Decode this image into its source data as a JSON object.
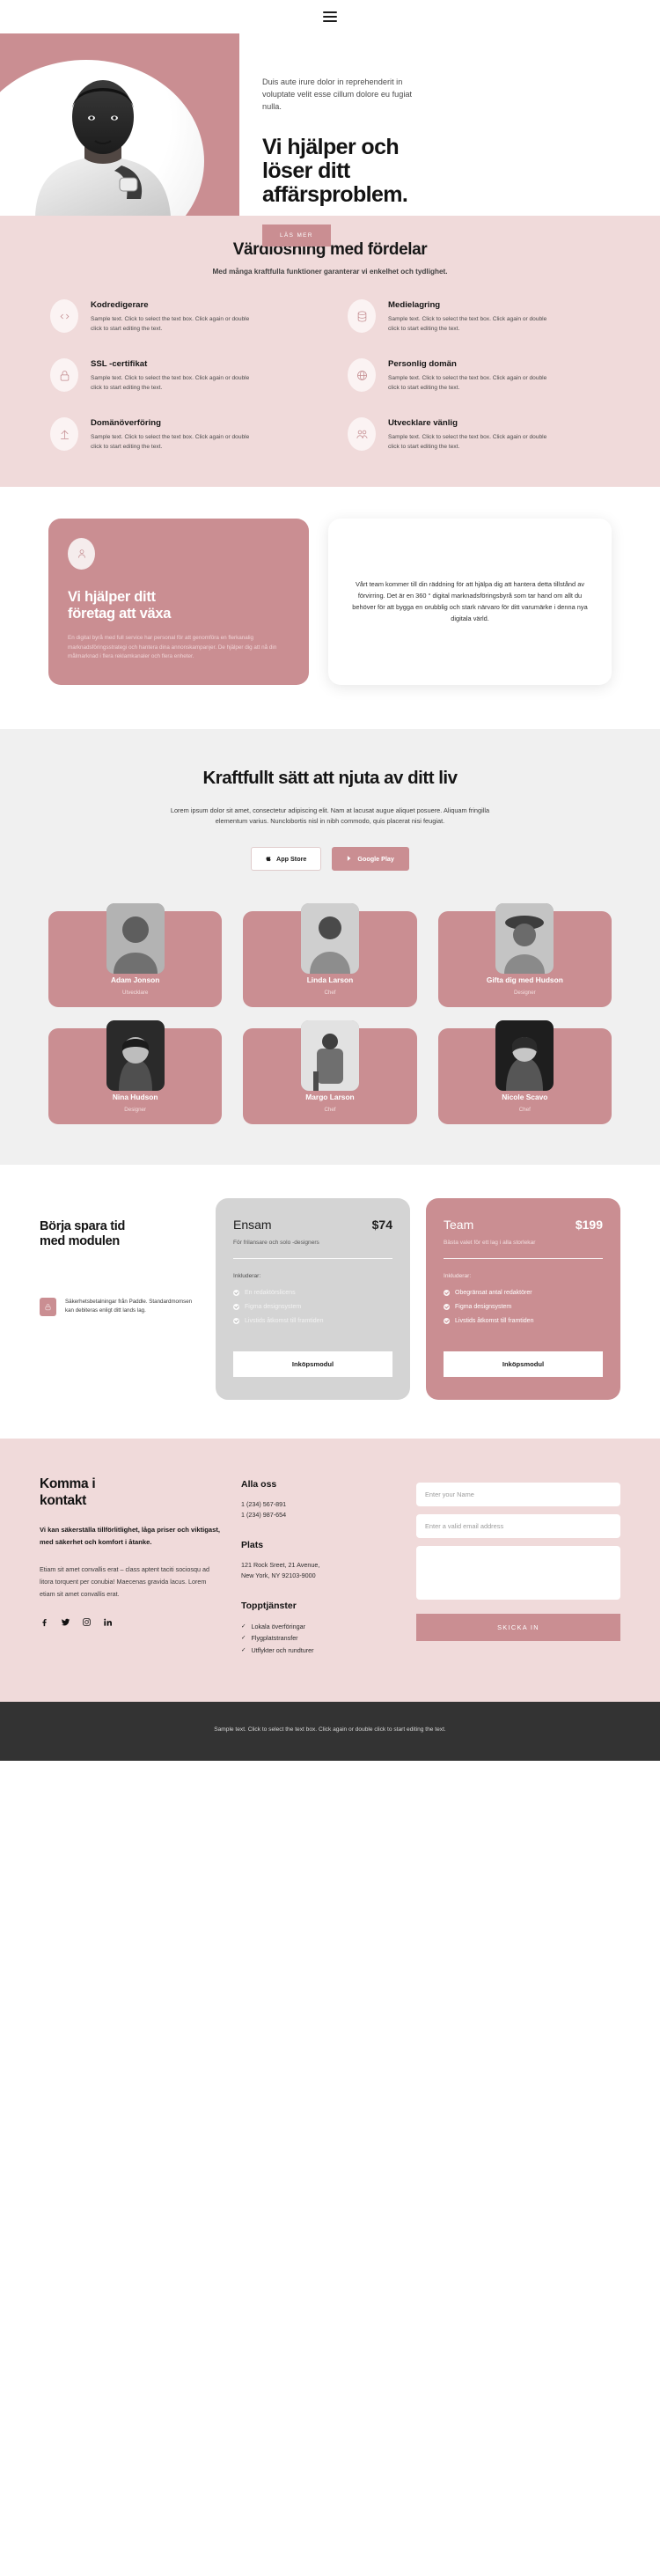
{
  "nav": {
    "menu_label": "menu"
  },
  "hero": {
    "kicker": "Duis aute irure dolor in reprehenderit in voluptate velit esse cillum dolore eu fugiat nulla.",
    "title_line1": "Vi hjälper och",
    "title_line2": "löser ditt",
    "title_line3": "affärsproblem.",
    "cta": "LÄS MER"
  },
  "features": {
    "title": "Värdlösning med fördelar",
    "subtitle": "Med många kraftfulla funktioner garanterar vi enkelhet och tydlighet.",
    "body": "Sample text. Click to select the text box. Click again or double click to start editing the text.",
    "items": [
      {
        "icon": "code-icon",
        "title": "Kodredigerare"
      },
      {
        "icon": "database-icon",
        "title": "Medielagring"
      },
      {
        "icon": "lock-icon",
        "title": "SSL -certifikat"
      },
      {
        "icon": "globe-icon",
        "title": "Personlig domän"
      },
      {
        "icon": "upload-icon",
        "title": "Domänöverföring"
      },
      {
        "icon": "users-icon",
        "title": "Utvecklare vänlig"
      }
    ]
  },
  "help": {
    "card_title_line1": "Vi hjälper ditt",
    "card_title_line2": "företag att växa",
    "card_text": "En digital byrå med full service har personal för att genomföra en flerkanalig marknadsföringsstrategi och hantera dina annonskampanjer. De hjälper dig att nå din målmarknad i flera reklamkanaler och flera enheter.",
    "quote": "Vårt team kommer till din räddning för att hjälpa dig att hantera detta tillstånd av förvirring. Det är en 360 ° digital marknadsföringsbyrå som tar hand om allt du behöver för att bygga en orubblig och stark närvaro för ditt varumärke i denna nya digitala värld."
  },
  "app": {
    "title": "Kraftfullt sätt att njuta av ditt liv",
    "paragraph": "Lorem ipsum dolor sit amet, consectetur adipiscing elit. Nam at lacusat augue aliquet posuere. Aliquam fringilla elementum varius. Nunclobortis nisl in nibh commodo, quis placerat nisi feugiat.",
    "app_store": "App Store",
    "google_play": "Google Play"
  },
  "team": {
    "members": [
      {
        "name": "Adam Jonson",
        "role": "Utvecklare"
      },
      {
        "name": "Linda Larson",
        "role": "Chef"
      },
      {
        "name": "Gifta dig med Hudson",
        "role": "Designer"
      },
      {
        "name": "Nina Hudson",
        "role": "Designer"
      },
      {
        "name": "Margo Larson",
        "role": "Chef"
      },
      {
        "name": "Nicole Scavo",
        "role": "Chef"
      }
    ]
  },
  "pricing": {
    "heading_line1": "Börja spara tid",
    "heading_line2": "med modulen",
    "secure_note": "Säkerhetsbetalningar från Paddle. Standardmomsen kan debiteras enligt ditt lands lag.",
    "includes_label": "Inkluderar:",
    "plans": [
      {
        "name": "Ensam",
        "price": "$74",
        "subtitle": "För frilansare och solo -designers",
        "features": [
          "En redaktörslicens",
          "Figma designsystem",
          "Livstids åtkomst till framtiden"
        ],
        "cta": "Inköpsmodul"
      },
      {
        "name": "Team",
        "price": "$199",
        "subtitle": "Bästa valet för ett lag i alla storlekar",
        "features": [
          "Obegränsat antal redaktörer",
          "Figma designsystem",
          "Livstids åtkomst till framtiden"
        ],
        "cta": "Inköpsmodul"
      }
    ]
  },
  "contact": {
    "title_line1": "Komma i",
    "title_line2": "kontakt",
    "lead": "Vi kan säkerställa tillförlitlighet, låga priser och viktigast, med säkerhet och komfort i åtanke.",
    "body": "Etiam sit amet convallis erat – class aptent taciti sociosqu ad litora torquent per conubia! Maecenas gravida lacus. Lorem etiam sit amet convallis erat.",
    "socials": [
      "facebook-icon",
      "twitter-icon",
      "instagram-icon",
      "linkedin-icon"
    ],
    "call_heading": "Alla oss",
    "phone1": "1 (234) 567-891",
    "phone2": "1 (234) 987-654",
    "place_heading": "Plats",
    "address_line1": "121 Rock Sreet, 21 Avenue,",
    "address_line2": "New York, NY 92103-9000",
    "services_heading": "Topptjänster",
    "services": [
      "Lokala överföringar",
      "Flygplatstransfer",
      "Utflykter och rundturer"
    ],
    "name_placeholder": "Enter your Name",
    "email_placeholder": "Enter a valid email address",
    "message_placeholder": "",
    "submit": "SKICKA IN"
  },
  "footer": {
    "text": "Sample text. Click to select the text box. Click again or double click to start editing the text."
  },
  "colors": {
    "accent": "#ca8e92",
    "soft_pink": "#f0dada",
    "grey_section": "#f0f0f0",
    "footer_dark": "#333333"
  }
}
